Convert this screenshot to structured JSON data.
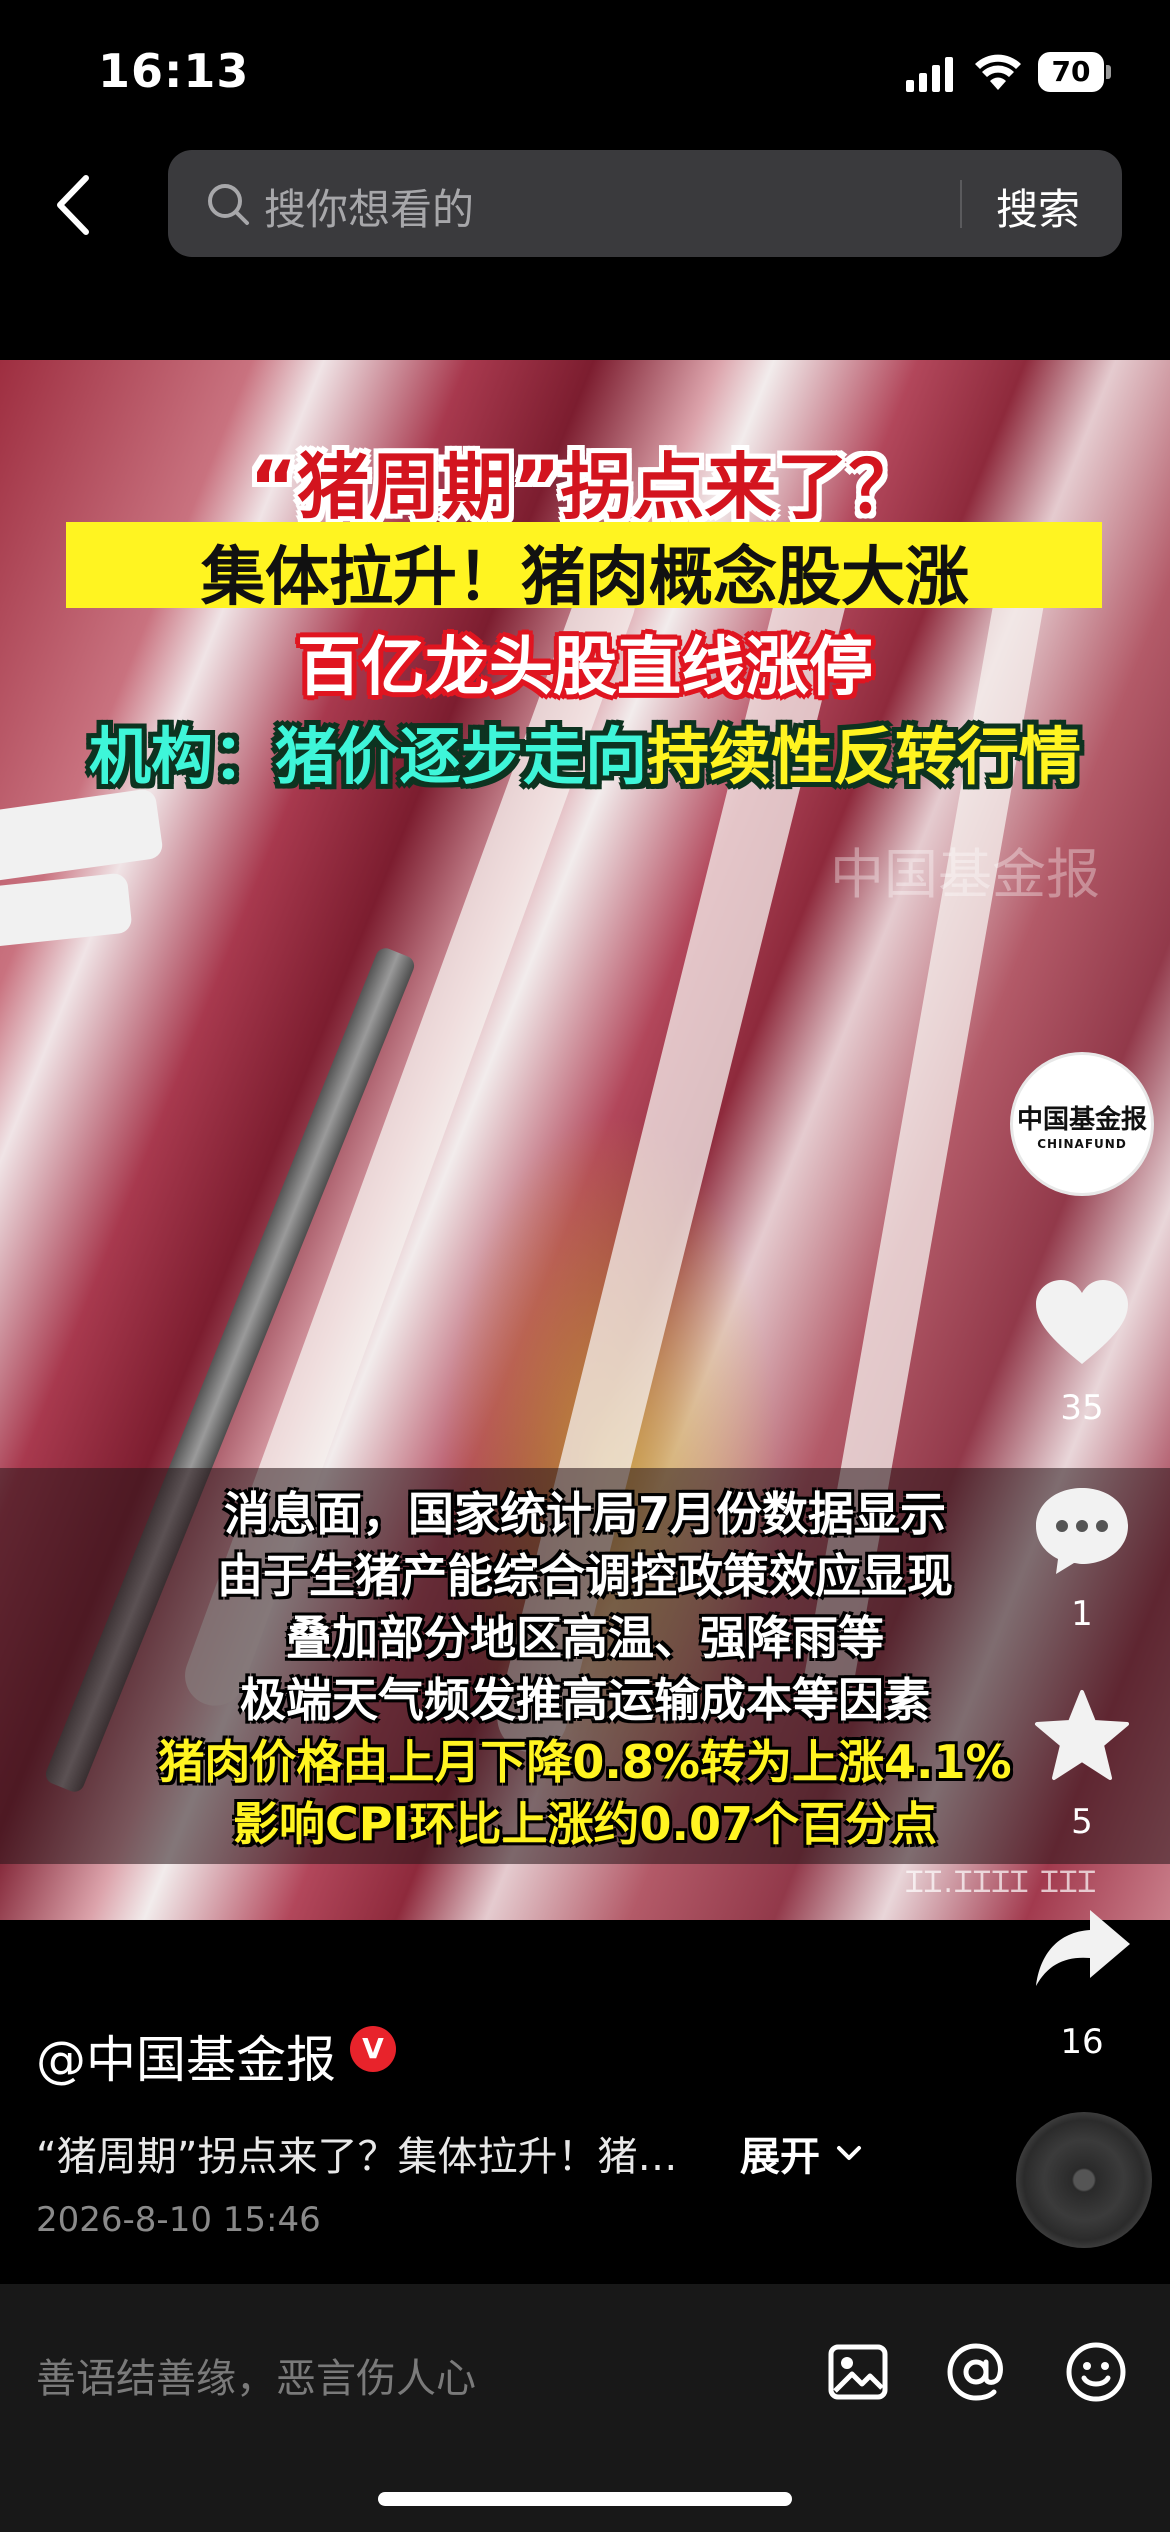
{
  "status_bar": {
    "time": "16:13",
    "battery": "70"
  },
  "search": {
    "placeholder": "搜你想看的",
    "button": "搜索"
  },
  "video": {
    "headlines": {
      "line1": "“猪周期”拐点来了？",
      "line2": "集体拉升！猪肉概念股大涨",
      "line3": "百亿龙头股直线涨停",
      "line4_cyan": "机构：猪价逐步走向",
      "line4_yellow": "持续性反转行情"
    },
    "subtitles": [
      "消息面，国家统计局7月份数据显示",
      "由于生猪产能综合调控政策效应显现",
      "叠加部分地区高温、强降雨等",
      "极端天气频发推高运输成本等因素",
      "猪肉价格由上月下降0.8%转为上涨4.1%",
      "影响CPI环比上涨约0.07个百分点"
    ],
    "watermark": "中国基金报",
    "small_watermark": "ꞮꞮ.ꞮꞮꞮꞮ ꞮꞮꞮ"
  },
  "sidebar": {
    "avatar": {
      "name": "中国基金报",
      "name_en": "CHINAFUND"
    },
    "likes": "35",
    "comments": "1",
    "favorites": "5",
    "shares": "16"
  },
  "post": {
    "author": "@中国基金报",
    "verified": "V",
    "caption": "“猪周期”拐点来了？集体拉升！猪…",
    "expand": "展开",
    "date": "2026-8-10 15:46"
  },
  "comment_bar": {
    "placeholder": "善语结善缘，恶言伤人心"
  },
  "colors": {
    "accent_red": "#e8232b",
    "title_yellow": "#fff421",
    "title_cyan": "#3ef6d9"
  }
}
